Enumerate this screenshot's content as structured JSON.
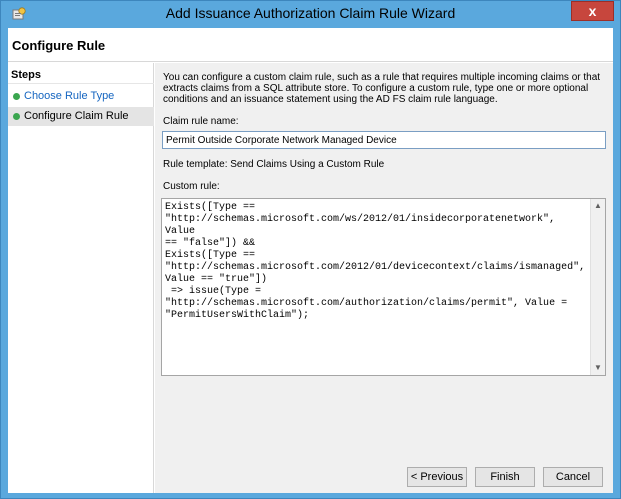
{
  "window": {
    "title": "Add Issuance Authorization Claim Rule Wizard",
    "close_label": "x"
  },
  "header": {
    "title": "Configure Rule"
  },
  "steps": {
    "heading": "Steps",
    "items": [
      {
        "label": "Choose Rule Type",
        "status": "done"
      },
      {
        "label": "Configure Claim Rule",
        "status": "current"
      }
    ]
  },
  "main": {
    "intro": "You can configure a custom claim rule, such as a rule that requires multiple incoming claims or that extracts claims from a SQL attribute store. To configure a custom rule, type one or more optional conditions and an issuance statement using the AD FS claim rule language.",
    "rule_name_label": "Claim rule name:",
    "rule_name_value": "Permit Outside Corporate Network Managed Device",
    "rule_template": "Rule template: Send Claims Using a Custom Rule",
    "custom_rule_label": "Custom rule:",
    "custom_rule_text": "Exists([Type ==\n\"http://schemas.microsoft.com/ws/2012/01/insidecorporatenetwork\", Value\n== \"false\"]) &&\nExists([Type ==\n\"http://schemas.microsoft.com/2012/01/devicecontext/claims/ismanaged\",\nValue == \"true\"])\n => issue(Type =\n\"http://schemas.microsoft.com/authorization/claims/permit\", Value =\n\"PermitUsersWithClaim\");"
  },
  "buttons": {
    "previous": "< Previous",
    "finish": "Finish",
    "cancel": "Cancel"
  },
  "colors": {
    "titlebar": "#5aa8dd",
    "close": "#c7463d",
    "step_done": "#3aa64f",
    "link": "#1565c0"
  }
}
